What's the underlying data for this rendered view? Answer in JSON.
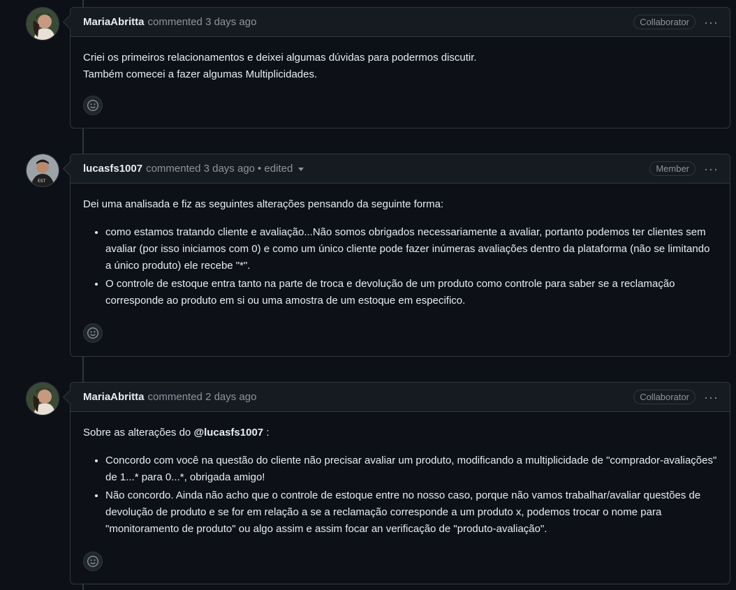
{
  "comments": [
    {
      "author": "MariaAbritta",
      "meta": "commented 3 days ago",
      "badge": "Collaborator",
      "paragraphs": [
        "Criei os primeiros relacionamentos e deixei algumas dúvidas para podermos discutir.",
        "Também comecei a fazer algumas Multiplicidades."
      ]
    },
    {
      "author": "lucasfs1007",
      "meta": "commented 3 days ago",
      "edited": "• edited",
      "badge": "Member",
      "intro": "Dei uma analisada e fiz as seguintes alterações pensando da seguinte forma:",
      "bullets": [
        "como estamos tratando cliente e avaliação...Não somos obrigados necessariamente a avaliar, portanto podemos ter clientes sem avaliar (por isso iniciamos com 0) e como um único cliente pode fazer inúmeras avaliações dentro da plataforma (não se limitando a único produto) ele recebe \"*\".",
        "O controle de estoque entra tanto na parte de troca e devolução de um produto como controle para saber se a reclamação corresponde ao produto em si ou uma amostra de um estoque em especifico."
      ]
    },
    {
      "author": "MariaAbritta",
      "meta": "commented 2 days ago",
      "badge": "Collaborator",
      "intro_before": "Sobre as alterações do",
      "mention": "@lucasfs1007",
      "intro_after": ":",
      "bullets": [
        "Concordo com você na questão do cliente não precisar avaliar um produto, modificando a multiplicidade de \"comprador-avaliações\" de 1...* para 0...*, obrigada amigo!",
        "Não concordo. Ainda não acho que o controle de estoque entre no nosso caso, porque não vamos trabalhar/avaliar questões de devolução de produto e se for em relação a se a reclamação corresponde a um produto x, podemos trocar o nome para \"monitoramento de produto\" ou algo assim e assim focar an verificação de \"produto-avaliação\"."
      ]
    }
  ],
  "icons": {
    "more": "kebab-horizontal-icon",
    "reaction": "smiley-icon"
  },
  "colors": {
    "background": "#0d1117",
    "header": "#161b22",
    "border": "#30363d",
    "muted": "#8b949e",
    "text": "#e6edf3"
  }
}
